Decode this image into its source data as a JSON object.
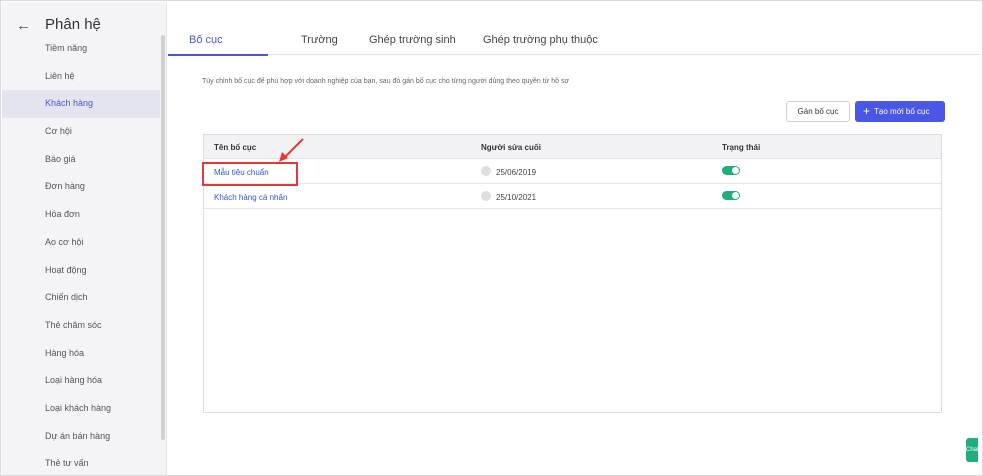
{
  "sidebar": {
    "title": "Phân hệ",
    "back_icon": "arrow-left-icon",
    "items": [
      {
        "label": "Tiềm năng"
      },
      {
        "label": "Liên hệ"
      },
      {
        "label": "Khách hàng"
      },
      {
        "label": "Cơ hội"
      },
      {
        "label": "Báo giá"
      },
      {
        "label": "Đơn hàng"
      },
      {
        "label": "Hóa đơn"
      },
      {
        "label": "Ao cơ hội"
      },
      {
        "label": "Hoạt động"
      },
      {
        "label": "Chiến dịch"
      },
      {
        "label": "Thẻ chăm sóc"
      },
      {
        "label": "Hàng hóa"
      },
      {
        "label": "Loại hàng hóa"
      },
      {
        "label": "Loại khách hàng"
      },
      {
        "label": "Dự án bán hàng"
      },
      {
        "label": "Thẻ tư vấn"
      }
    ],
    "active_index": 2
  },
  "tabs": [
    {
      "label": "Bố cục"
    },
    {
      "label": "Trường"
    },
    {
      "label": "Ghép trường sinh"
    },
    {
      "label": "Ghép trường phụ thuộc"
    }
  ],
  "description": "Tùy chỉnh bố cục để phù hợp với doanh nghiệp của bạn, sau đó gán bố cục cho từng người dùng theo quyền từ hồ sơ",
  "actions": {
    "assign_label": "Gán bố cục",
    "create_label": "Tạo mới bố cục"
  },
  "table": {
    "headers": {
      "name": "Tên bố cục",
      "modified_by": "Người sửa cuối",
      "status": "Trạng thái"
    },
    "rows": [
      {
        "name": "Mẫu tiêu chuẩn",
        "date": "25/06/2019",
        "status": "on"
      },
      {
        "name": "Khách hàng cá nhân",
        "date": "25/10/2021",
        "status": "on"
      }
    ]
  },
  "chat_label": "Chat",
  "colors": {
    "accent": "#4a57e6",
    "toggle_on": "#1fae7c",
    "highlight": "#e53935"
  }
}
